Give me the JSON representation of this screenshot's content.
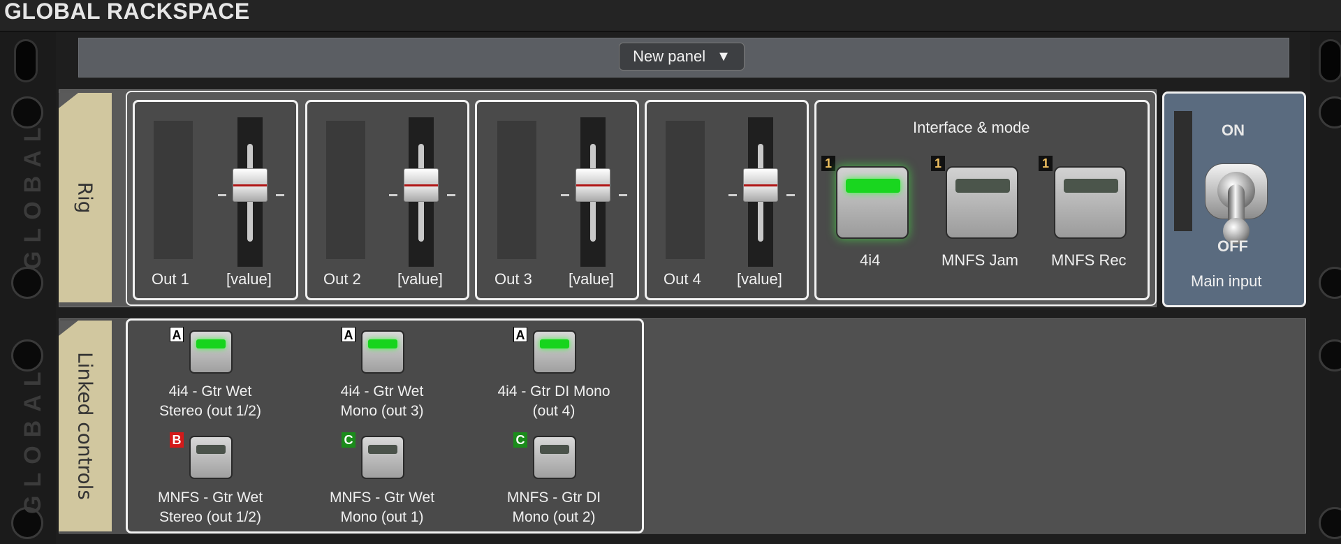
{
  "window": {
    "title": "GLOBAL RACKSPACE"
  },
  "topbar": {
    "panel_select": "New panel",
    "arrow": "▼"
  },
  "rails": {
    "label": "GLOBAL"
  },
  "rig": {
    "tag": "Rig",
    "outputs": [
      {
        "label": "Out 1",
        "value": "[value]"
      },
      {
        "label": "Out 2",
        "value": "[value]"
      },
      {
        "label": "Out 3",
        "value": "[value]"
      },
      {
        "label": "Out 4",
        "value": "[value]"
      }
    ],
    "interface": {
      "title": "Interface & mode",
      "buttons": [
        {
          "label": "4i4",
          "badge": "1",
          "state": "on"
        },
        {
          "label": "MNFS Jam",
          "badge": "1",
          "state": "off"
        },
        {
          "label": "MNFS Rec",
          "badge": "1",
          "state": "off"
        }
      ]
    },
    "main_input": {
      "on_label": "ON",
      "off_label": "OFF",
      "label": "Main input"
    }
  },
  "linked": {
    "tag": "Linked controls",
    "buttons": [
      {
        "badge": "A",
        "line1": "4i4 -  Gtr Wet",
        "line2": "Stereo (out 1/2)",
        "state": "on"
      },
      {
        "badge": "A",
        "line1": "4i4 - Gtr Wet",
        "line2": "Mono (out 3)",
        "state": "on"
      },
      {
        "badge": "A",
        "line1": "4i4 - Gtr DI Mono",
        "line2": "(out 4)",
        "state": "on"
      },
      {
        "badge": "B",
        "line1": "MNFS - Gtr Wet",
        "line2": "Stereo (out 1/2)",
        "state": "off"
      },
      {
        "badge": "C",
        "line1": "MNFS - Gtr Wet",
        "line2": "Mono (out 1)",
        "state": "off"
      },
      {
        "badge": "C",
        "line1": "MNFS - Gtr DI",
        "line2": "Mono (out 2)",
        "state": "off"
      }
    ]
  },
  "colors": {
    "led_on": "#19d61f",
    "led_off": "#4b554b",
    "badge_b": "#d31a1a",
    "badge_c": "#1b8b1b",
    "tag": "#d1c79f"
  }
}
